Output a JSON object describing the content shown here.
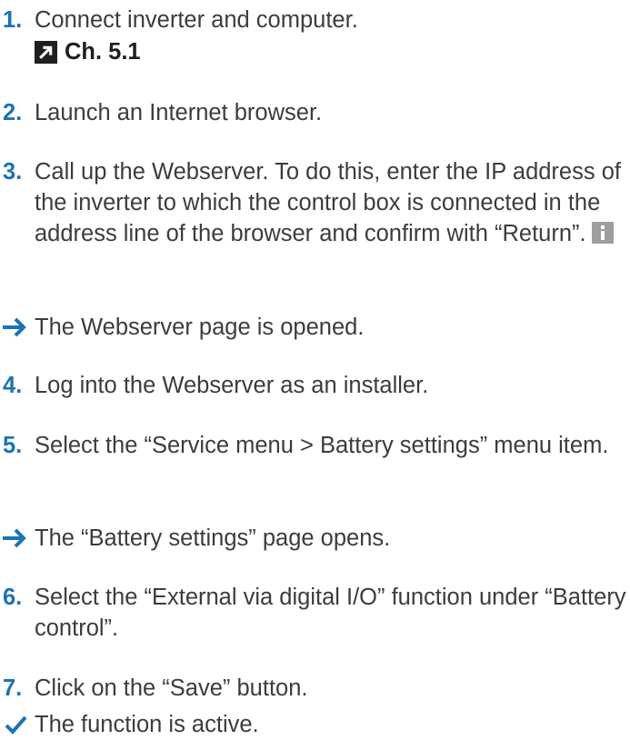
{
  "steps": [
    {
      "number": "1.",
      "text": "Connect inverter and computer.",
      "reference": "Ch. 5.1"
    },
    {
      "number": "2.",
      "text": "Launch an Internet browser."
    },
    {
      "number": "3.",
      "text": "Call up the Webserver. To do this, enter the IP address of the inverter to which the control box is connected in the address line of the browser and confirm with “Return”."
    },
    {
      "result": "The Webserver page is opened."
    },
    {
      "number": "4.",
      "text": "Log into the Webserver as an installer."
    },
    {
      "number": "5.",
      "text": "Select the “Service menu > Battery settings” menu item."
    },
    {
      "result": "The “Battery settings” page opens."
    },
    {
      "number": "6.",
      "text": "Select the “External via digital I/O” function under “Battery control”."
    },
    {
      "number": "7.",
      "text": "Click on the “Save” button."
    },
    {
      "final": "The function is active."
    }
  ],
  "icons": {
    "reference": "link-arrow-icon",
    "info": "info-icon",
    "result": "arrow-right-icon",
    "final": "checkmark-icon"
  },
  "colors": {
    "step_number": "#1a73b5",
    "text": "#3c3c3c",
    "icon_dark": "#1f1f1f",
    "info_icon": "#9e9e9e"
  }
}
